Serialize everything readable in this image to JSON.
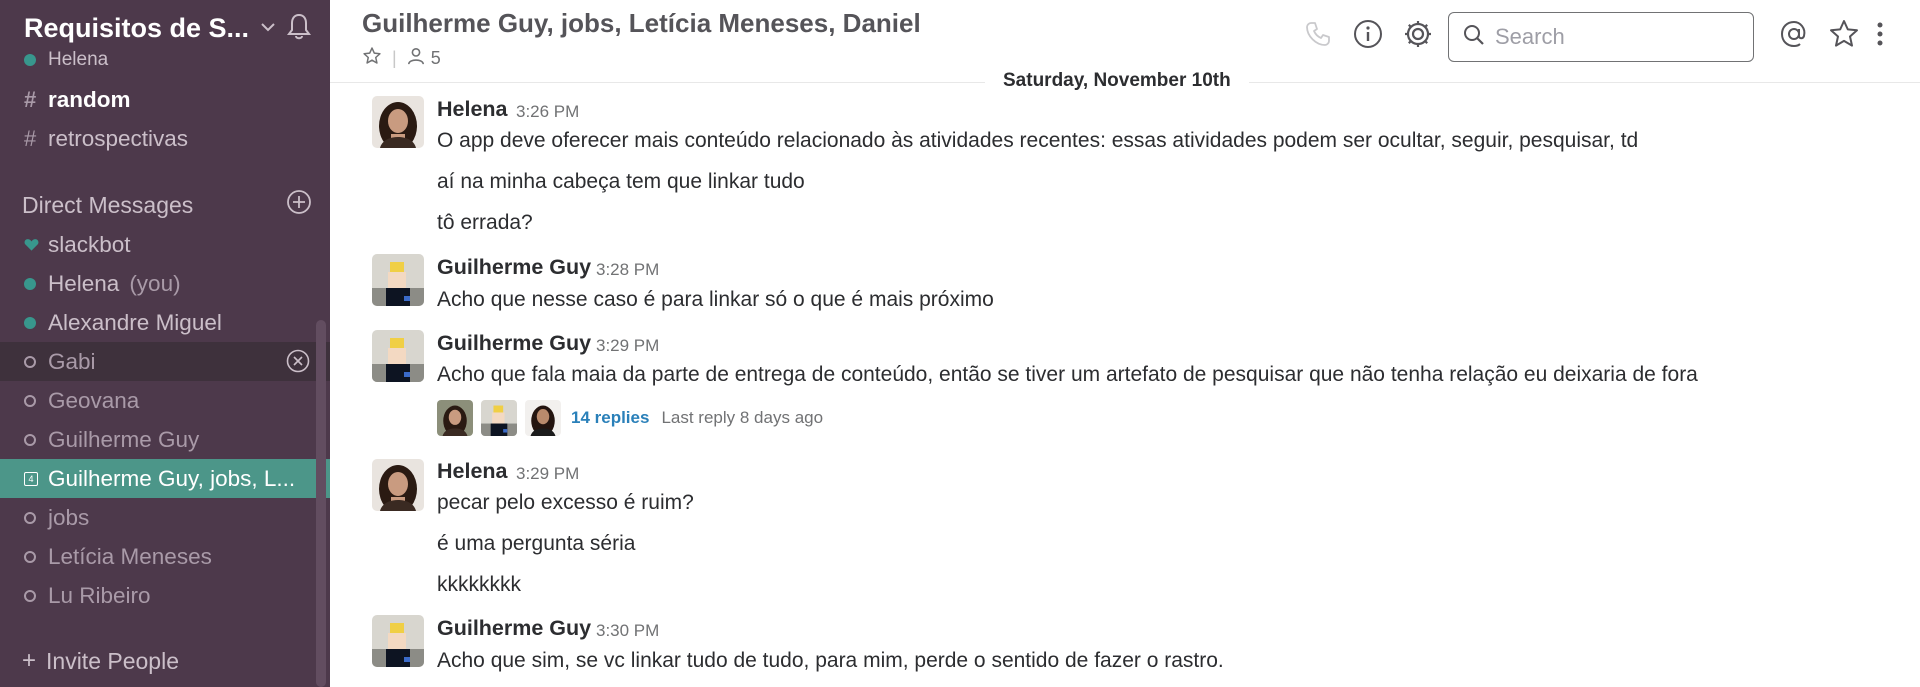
{
  "sidebar": {
    "team_name": "Requisitos de S...",
    "user_status": "Helena",
    "channels": [
      {
        "name": "random",
        "bold": true
      },
      {
        "name": "retrospectivas",
        "bold": false
      }
    ],
    "direct_messages_label": "Direct Messages",
    "dms": [
      {
        "name": "slackbot",
        "presence": "heart"
      },
      {
        "name": "Helena",
        "suffix": "(you)",
        "presence": "online"
      },
      {
        "name": "Alexandre Miguel",
        "presence": "online"
      },
      {
        "name": "Gabi",
        "presence": "offline",
        "hover": true
      },
      {
        "name": "Geovana",
        "presence": "offline"
      },
      {
        "name": "Guilherme Guy",
        "presence": "offline"
      },
      {
        "name": "Guilherme Guy, jobs, L...",
        "presence": "group",
        "count": "4",
        "active": true
      },
      {
        "name": "jobs",
        "presence": "offline"
      },
      {
        "name": "Letícia Meneses",
        "presence": "offline"
      },
      {
        "name": "Lu Ribeiro",
        "presence": "offline"
      }
    ],
    "invite_label": "Invite People"
  },
  "header": {
    "title": "Guilherme Guy, jobs, Letícia Meneses, Daniel",
    "member_count": "5",
    "search_placeholder": "Search"
  },
  "date_divider": "Saturday, November 10th",
  "messages": [
    {
      "author": "Helena",
      "time": "3:26 PM",
      "avatar": "helena",
      "lines": [
        "O app deve oferecer mais conteúdo relacionado às atividades recentes: essas atividades podem ser ocultar, seguir, pesquisar, td",
        "aí na minha cabeça tem que linkar tudo",
        "tô errada?"
      ]
    },
    {
      "author": "Guilherme Guy",
      "time": "3:28 PM",
      "avatar": "guilherme",
      "lines": [
        "Acho que nesse caso é para linkar só o que é mais próximo"
      ]
    },
    {
      "author": "Guilherme Guy",
      "time": "3:29 PM",
      "avatar": "guilherme",
      "lines": [
        "Acho que fala maia da parte de entrega de conteúdo,  então se tiver um artefato de pesquisar que não tenha relação eu deixaria de fora"
      ],
      "thread": {
        "replies": "14 replies",
        "last_reply": "Last reply 8 days ago"
      }
    },
    {
      "author": "Helena",
      "time": "3:29 PM",
      "avatar": "helena",
      "lines": [
        "pecar pelo excesso é ruim?",
        "é uma pergunta séria",
        "kkkkkkkk"
      ]
    },
    {
      "author": "Guilherme Guy",
      "time": "3:30 PM",
      "avatar": "guilherme",
      "lines": [
        "Acho que sim, se vc linkar tudo de tudo, para mim, perde o sentido de fazer o rastro."
      ]
    }
  ],
  "colors": {
    "sidebar_bg": "#4d394b",
    "active_row": "#4c9689",
    "presence_online": "#38978d",
    "link": "#2a80b9"
  }
}
